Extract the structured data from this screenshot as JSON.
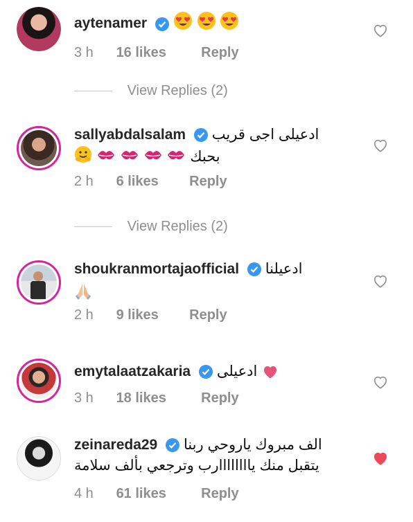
{
  "comments": [
    {
      "username": "aytenamer",
      "text": "",
      "text2": "",
      "time": "3 h",
      "likes": "16 likes",
      "reply": "Reply",
      "liked": false,
      "emojis": [
        "heart-eyes",
        "heart-eyes",
        "heart-eyes"
      ]
    },
    {
      "username": "sallyabdalsalam",
      "text": "ادعيلى اجى قريب",
      "text2": "بحبك",
      "time": "2 h",
      "likes": "6 likes",
      "reply": "Reply",
      "liked": false
    },
    {
      "username": "shoukranmortajaofficial",
      "text": "ادعيلنا",
      "text2": "",
      "time": "2 h",
      "likes": "9 likes",
      "reply": "Reply",
      "liked": false
    },
    {
      "username": "emytalaatzakaria",
      "text": "ادعيلى",
      "text2": "",
      "time": "3 h",
      "likes": "18 likes",
      "reply": "Reply",
      "liked": false
    },
    {
      "username": "zeinareda29",
      "text": "الف مبروك ياروحي ربنا",
      "text2": "يتقبل منك ياااااااارب وترجعي بألف سلامة",
      "time": "4 h",
      "likes": "61 likes",
      "reply": "Reply",
      "liked": true
    }
  ],
  "view_replies": [
    "View Replies (2)",
    "View Replies (2)"
  ],
  "colors": {
    "liked_heart": "#ed4956",
    "verified": "#3897f0",
    "meta": "#8e8e8e"
  }
}
